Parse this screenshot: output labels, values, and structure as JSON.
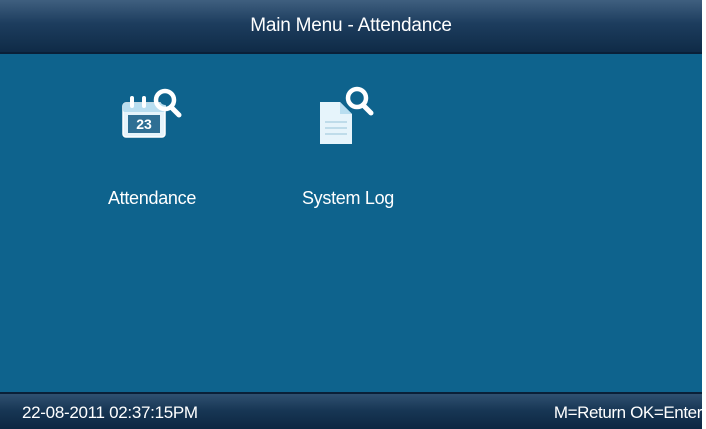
{
  "header": {
    "title": "Main Menu - Attendance"
  },
  "menu": {
    "items": [
      {
        "label": "Attendance",
        "icon": "calendar-search-icon",
        "badge": "23"
      },
      {
        "label": "System Log",
        "icon": "document-search-icon"
      }
    ]
  },
  "status": {
    "datetime": "22-08-2011  02:37:15PM",
    "keys_hint": "M=Return OK=Enter"
  },
  "colors": {
    "background": "#0e638d",
    "title_bar": "#1d3d5e",
    "icon_fill": "#d6eef8",
    "text": "#ffffff"
  }
}
